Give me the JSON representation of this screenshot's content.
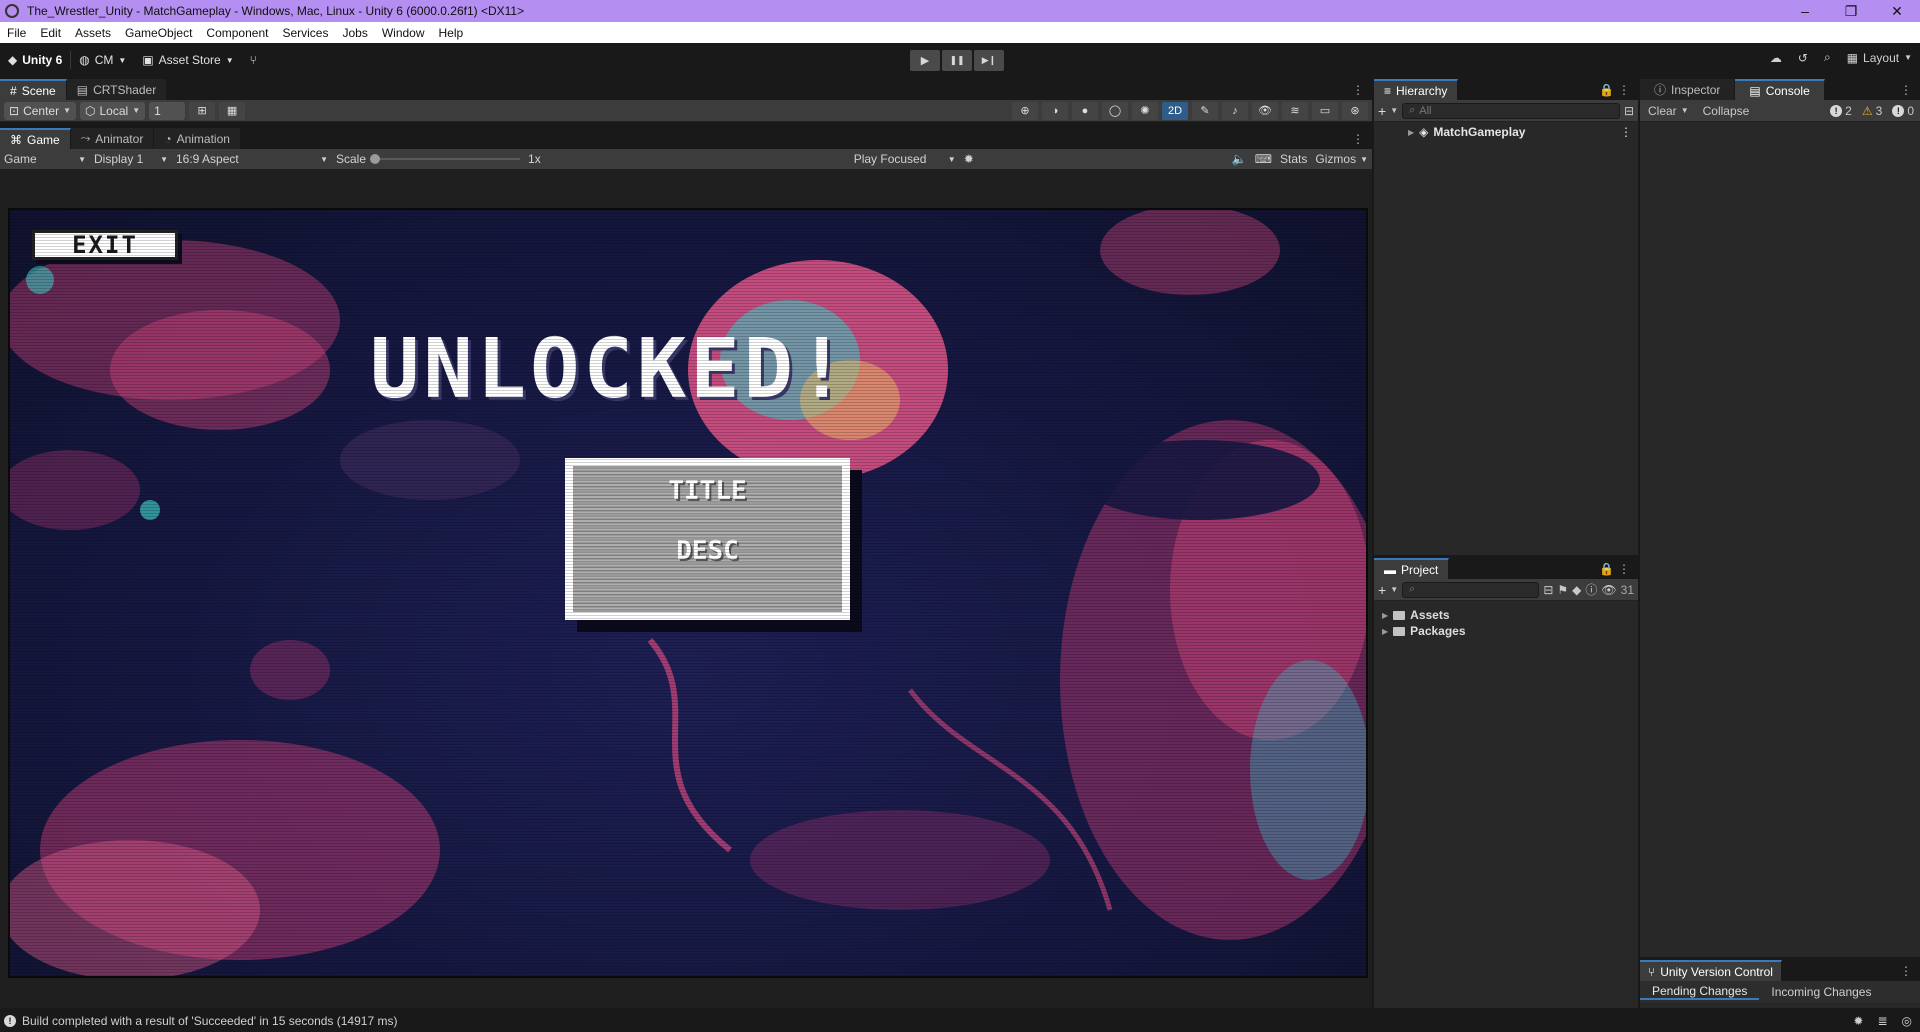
{
  "window": {
    "title": "The_Wrestler_Unity - MatchGameplay - Windows, Mac, Linux - Unity 6 (6000.0.26f1) <DX11>",
    "controls": [
      "–",
      "❐",
      "✕"
    ]
  },
  "menu": [
    "File",
    "Edit",
    "Assets",
    "GameObject",
    "Component",
    "Services",
    "Jobs",
    "Window",
    "Help"
  ],
  "toolbar": {
    "unity_label": "Unity 6",
    "account_label": "CM",
    "asset_store_label": "Asset Store",
    "layout_label": "Layout",
    "play_glyph": "▶",
    "pause_glyph": "❚❚",
    "step_glyph": "▶❙"
  },
  "scene_panel": {
    "tabs": [
      "Scene",
      "CRTShader"
    ],
    "pivot": "Center",
    "space": "Local",
    "snap_value": "1",
    "mode_2d": "2D"
  },
  "game_panel": {
    "tabs": [
      "Game",
      "Animator",
      "Animation"
    ],
    "view": "Game",
    "display": "Display 1",
    "aspect": "16:9 Aspect",
    "scale_label": "Scale",
    "scale_value": "1x",
    "scale_level": 0.0,
    "play_mode": "Play Focused",
    "stats_label": "Stats",
    "gizmos_label": "Gizmos"
  },
  "game": {
    "exit_label": "EXIT",
    "unlocked_text": "UNLOCKED!",
    "card_title": "TITLE",
    "card_desc": "DESC"
  },
  "hierarchy": {
    "tab_label": "Hierarchy",
    "search_placeholder": "All",
    "root_item": "MatchGameplay"
  },
  "inspector": {
    "tab_label": "Inspector"
  },
  "console": {
    "tab_label": "Console",
    "clear_label": "Clear",
    "collapse_label": "Collapse",
    "info_count": "2",
    "warning_count": "3",
    "error_count": "0"
  },
  "project": {
    "tab_label": "Project",
    "item_count": "31",
    "folders": [
      "Assets",
      "Packages"
    ]
  },
  "version_control": {
    "tab_label": "Unity Version Control",
    "pending_label": "Pending Changes",
    "incoming_label": "Incoming Changes"
  },
  "status": {
    "message": "Build completed with a result of 'Succeeded' in 15 seconds (14917 ms)"
  },
  "colors": {
    "title_bar": "#b48ef0",
    "active_tab_accent": "#3a79bb",
    "warning": "#e8b52a"
  }
}
